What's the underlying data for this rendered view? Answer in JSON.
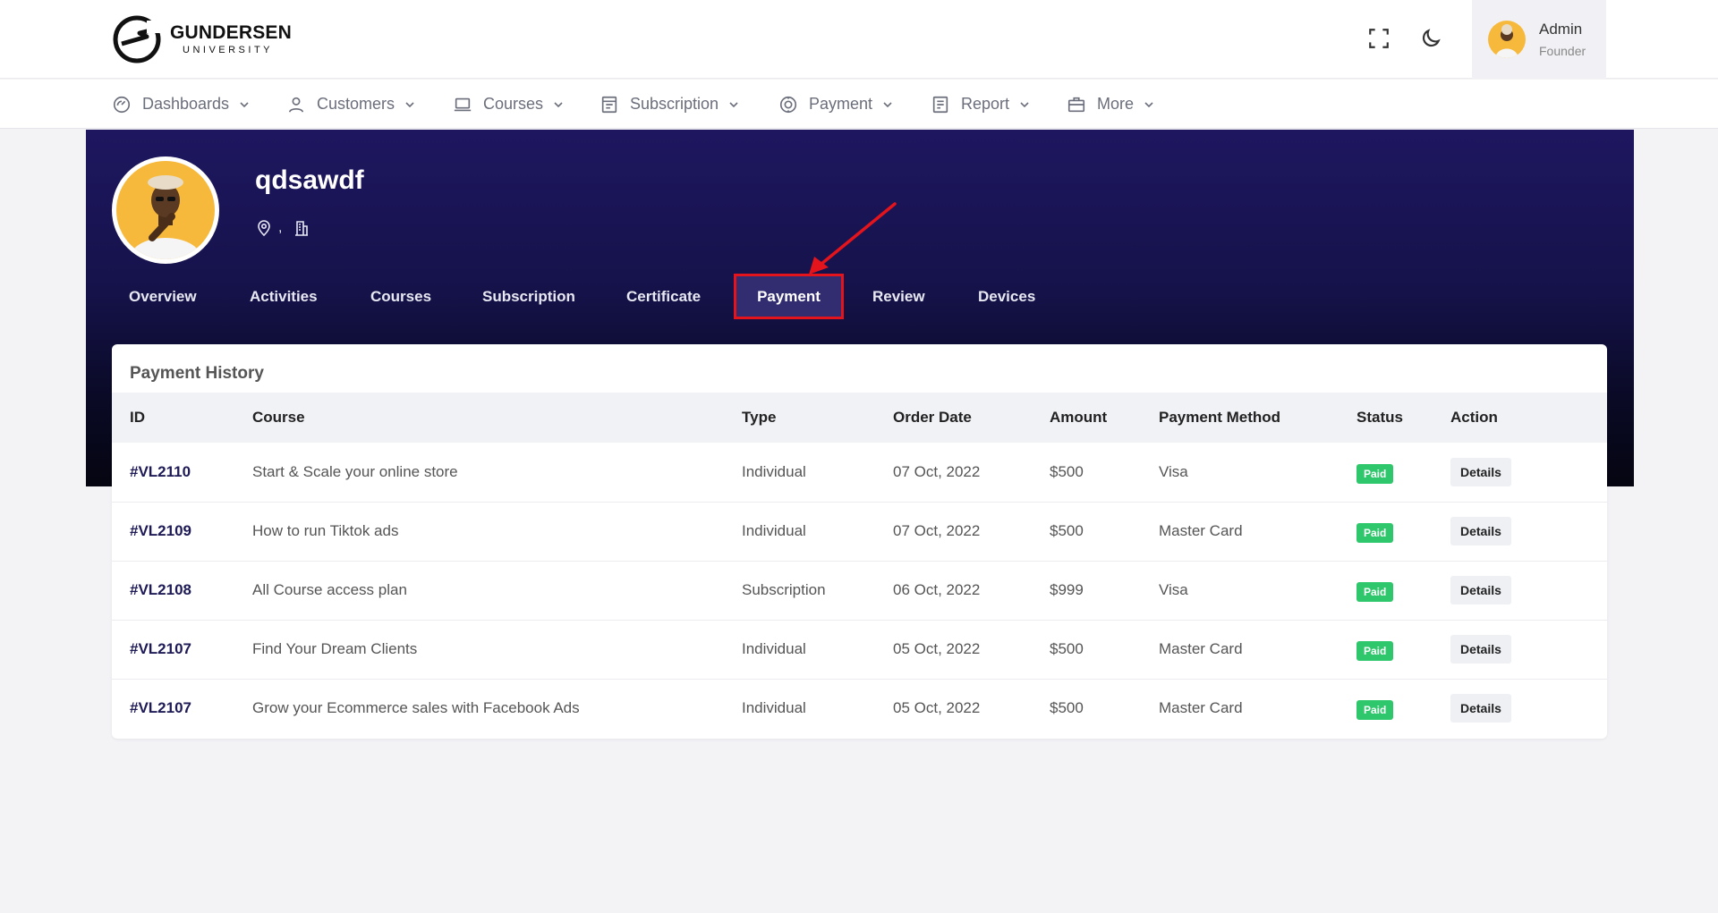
{
  "brand": {
    "name": "GUNDERSEN",
    "sub": "UNIVERSITY"
  },
  "header": {
    "fullscreen_icon": "fullscreen-icon",
    "theme_icon": "moon-icon",
    "user": {
      "name": "Admin",
      "role": "Founder"
    }
  },
  "nav": [
    {
      "label": "Dashboards",
      "icon": "dashboard-icon"
    },
    {
      "label": "Customers",
      "icon": "user-icon"
    },
    {
      "label": "Courses",
      "icon": "laptop-icon"
    },
    {
      "label": "Subscription",
      "icon": "subscription-icon"
    },
    {
      "label": "Payment",
      "icon": "coin-icon"
    },
    {
      "label": "Report",
      "icon": "report-icon"
    },
    {
      "label": "More",
      "icon": "briefcase-icon"
    }
  ],
  "profile": {
    "name": "qdsawdf",
    "location_sep": ","
  },
  "tabs": [
    {
      "label": "Overview"
    },
    {
      "label": "Activities"
    },
    {
      "label": "Courses"
    },
    {
      "label": "Subscription"
    },
    {
      "label": "Certificate"
    },
    {
      "label": "Payment"
    },
    {
      "label": "Review"
    },
    {
      "label": "Devices"
    }
  ],
  "active_tab": "Payment",
  "colors": {
    "accent": "#1e1760",
    "highlight": "#e3141b",
    "paid": "#2fc76c"
  },
  "payment_history": {
    "title": "Payment History",
    "columns": [
      "ID",
      "Course",
      "Type",
      "Order Date",
      "Amount",
      "Payment Method",
      "Status",
      "Action"
    ],
    "rows": [
      {
        "id": "#VL2110",
        "course": "Start & Scale your online store",
        "type": "Individual",
        "date": "07 Oct, 2022",
        "amount": "$500",
        "method": "Visa",
        "status": "Paid",
        "action": "Details"
      },
      {
        "id": "#VL2109",
        "course": "How to run Tiktok ads",
        "type": "Individual",
        "date": "07 Oct, 2022",
        "amount": "$500",
        "method": "Master Card",
        "status": "Paid",
        "action": "Details"
      },
      {
        "id": "#VL2108",
        "course": "All Course access plan",
        "type": "Subscription",
        "date": "06 Oct, 2022",
        "amount": "$999",
        "method": "Visa",
        "status": "Paid",
        "action": "Details"
      },
      {
        "id": "#VL2107",
        "course": "Find Your Dream Clients",
        "type": "Individual",
        "date": "05 Oct, 2022",
        "amount": "$500",
        "method": "Master Card",
        "status": "Paid",
        "action": "Details"
      },
      {
        "id": "#VL2107",
        "course": "Grow your Ecommerce sales with Facebook Ads",
        "type": "Individual",
        "date": "05 Oct, 2022",
        "amount": "$500",
        "method": "Master Card",
        "status": "Paid",
        "action": "Details"
      }
    ]
  }
}
